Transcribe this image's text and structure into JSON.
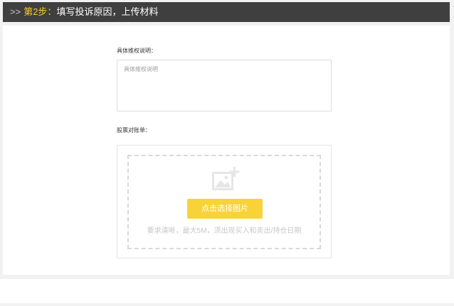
{
  "header": {
    "arrows": ">>",
    "step": "第2步",
    "separator": "：",
    "title": "填写投诉原因，上传材料"
  },
  "form": {
    "description_label": "具体维权说明：",
    "description_placeholder": "具体维权说明",
    "proof_label": "股票对账单：",
    "upload": {
      "icon": "image-add-icon",
      "button_label": "点击选择图片",
      "hint": "要求清晰，最大5M，须出现买入和卖出/持仓日期"
    }
  },
  "colors": {
    "header_bg": "#3f3f3f",
    "accent": "#f6cd2e",
    "button": "#f7d338"
  }
}
